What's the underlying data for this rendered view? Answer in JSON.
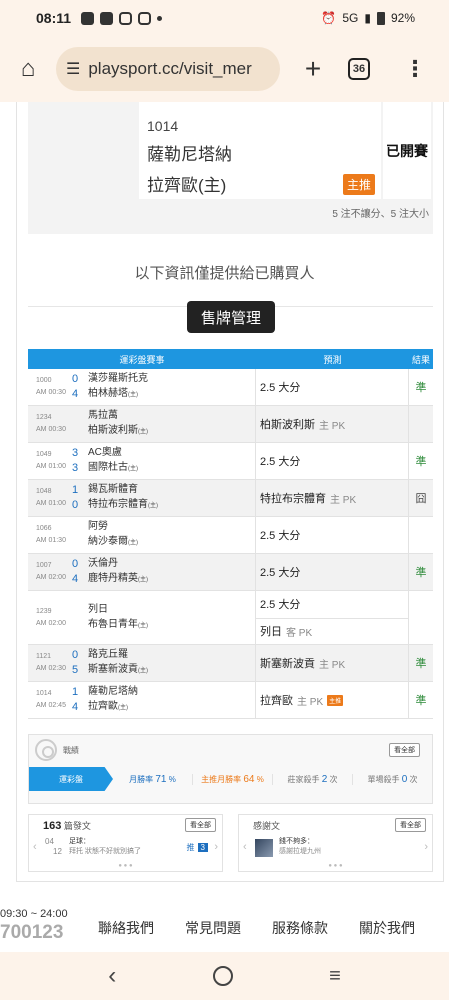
{
  "status_bar": {
    "time": "08:11",
    "network": "5G",
    "battery": "92%"
  },
  "browser": {
    "url": "playsport.cc/visit_mer",
    "tab_count": "36"
  },
  "top_match": {
    "number": "1014",
    "home_team": "薩勒尼塔納",
    "away_team": "拉齊歐(主)",
    "badge": "主推",
    "status": "已開賽",
    "note": "5 注不讓分、5 注大小"
  },
  "notice": "以下資訊僅提供給已購買人",
  "sell_button": "售牌管理",
  "table": {
    "headers": [
      "運彩盤賽事",
      "預測",
      "結果"
    ],
    "rows": [
      {
        "id": "1000",
        "time": "AM 00:30",
        "score1": "0",
        "score2": "4",
        "team1": "漢莎羅斯托克",
        "team2": "柏林赫塔",
        "team2_host": true,
        "pred": "2.5 大分",
        "pred_extra": "",
        "result": "準",
        "result_type": "ok"
      },
      {
        "id": "1234",
        "time": "AM 00:30",
        "score1": "",
        "score2": "",
        "team1": "馬拉萬",
        "team2": "柏斯波利斯",
        "team2_host": true,
        "pred": "柏斯波利斯",
        "pred_extra": "主 PK",
        "result": "",
        "result_type": ""
      },
      {
        "id": "1049",
        "time": "AM 01:00",
        "score1": "3",
        "score2": "3",
        "team1": "AC奧盧",
        "team2": "國際杜古",
        "team2_host": true,
        "pred": "2.5 大分",
        "pred_extra": "",
        "result": "準",
        "result_type": "ok"
      },
      {
        "id": "1048",
        "time": "AM 01:00",
        "score1": "1",
        "score2": "0",
        "team1": "錫瓦斯體育",
        "team2": "特拉布宗體育",
        "team2_host": true,
        "pred": "特拉布宗體育",
        "pred_extra": "主 PK",
        "result": "囧",
        "result_type": "miss"
      },
      {
        "id": "1066",
        "time": "AM 01:30",
        "score1": "",
        "score2": "",
        "team1": "阿勞",
        "team2": "納沙泰爾",
        "team2_host": true,
        "pred": "2.5 大分",
        "pred_extra": "",
        "result": "",
        "result_type": ""
      },
      {
        "id": "1007",
        "time": "AM 02:00",
        "score1": "0",
        "score2": "4",
        "team1": "沃倫丹",
        "team2": "鹿特丹精英",
        "team2_host": true,
        "pred": "2.5 大分",
        "pred_extra": "",
        "result": "準",
        "result_type": "ok"
      },
      {
        "id": "1239",
        "time": "AM 02:00",
        "score1": "",
        "score2": "",
        "team1": "列日",
        "team2": "布魯日青年",
        "team2_host": true,
        "pred": "2.5 大分",
        "pred2": "列日",
        "pred2_extra": "客 PK",
        "result": "",
        "result_type": ""
      },
      {
        "id": "1121",
        "time": "AM 02:30",
        "score1": "0",
        "score2": "5",
        "team1": "路克丘羅",
        "team2": "斯塞新波貢",
        "team2_host": true,
        "pred": "斯塞新波貢",
        "pred_extra": "主 PK",
        "result": "準",
        "result_type": "ok"
      },
      {
        "id": "1014",
        "time": "AM 02:45",
        "score1": "1",
        "score2": "4",
        "team1": "薩勒尼塔納",
        "team2": "拉齊歐",
        "team2_host": true,
        "pred": "拉齊歐",
        "pred_extra": "主 PK",
        "pred_badge": "主推",
        "result": "準",
        "result_type": "ok"
      }
    ],
    "host_mark": "(主)"
  },
  "record": {
    "title": "戰績",
    "see_all": "看全部",
    "lead": "運彩盤",
    "stat1_label": "月勝率",
    "stat1_value": "71",
    "stat1_unit": "%",
    "stat2_label": "主推月勝率",
    "stat2_value": "64",
    "stat2_unit": "%",
    "stat3_label": "莊家殺手",
    "stat3_value": "2",
    "stat3_unit": "次",
    "stat4_label": "單場殺手",
    "stat4_value": "0",
    "stat4_unit": "次"
  },
  "posts_card": {
    "count": "163",
    "label": "篇發文",
    "see_all": "看全部",
    "date_month": "04",
    "date_day": "12",
    "category": "足球：",
    "text": "拜托 狀態不好就別搞了",
    "push_label": "推",
    "push_count": "3"
  },
  "thanks_card": {
    "label": "感謝文",
    "see_all": "看全部",
    "title": "錢不夠多：",
    "text": "感謝拉堤九州"
  },
  "footer": {
    "hours": "09:30 ~ 24:00",
    "phone": "700123",
    "links": [
      "聯絡我們",
      "常見問題",
      "服務條款",
      "關於我們"
    ]
  }
}
